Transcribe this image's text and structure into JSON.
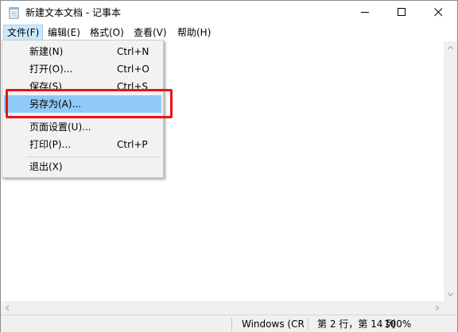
{
  "window": {
    "title": "新建文本文档 - 记事本",
    "controls": [
      "minimize",
      "maximize",
      "close"
    ]
  },
  "menubar": {
    "items": [
      {
        "label": "文件(F)"
      },
      {
        "label": "编辑(E)"
      },
      {
        "label": "格式(O)"
      },
      {
        "label": "查看(V)"
      },
      {
        "label": "帮助(H)"
      }
    ]
  },
  "file_menu": {
    "items": [
      {
        "label": "新建(N)",
        "shortcut": "Ctrl+N"
      },
      {
        "label": "打开(O)...",
        "shortcut": "Ctrl+O"
      },
      {
        "label": "保存(S)",
        "shortcut": "Ctrl+S"
      },
      {
        "label": "另存为(A)...",
        "shortcut": ""
      },
      {
        "label": "页面设置(U)...",
        "shortcut": ""
      },
      {
        "label": "打印(P)...",
        "shortcut": "Ctrl+P"
      },
      {
        "label": "退出(X)",
        "shortcut": ""
      }
    ],
    "highlighted": "另存为(A)..."
  },
  "statusbar": {
    "encoding": "Windows (CR",
    "position": "第 2 行，第 14 列",
    "zoom": "100%"
  },
  "colors": {
    "menu_hover": "#91c9f7",
    "active_menu": "#cce8ff",
    "annotation_red": "#e8141b"
  }
}
